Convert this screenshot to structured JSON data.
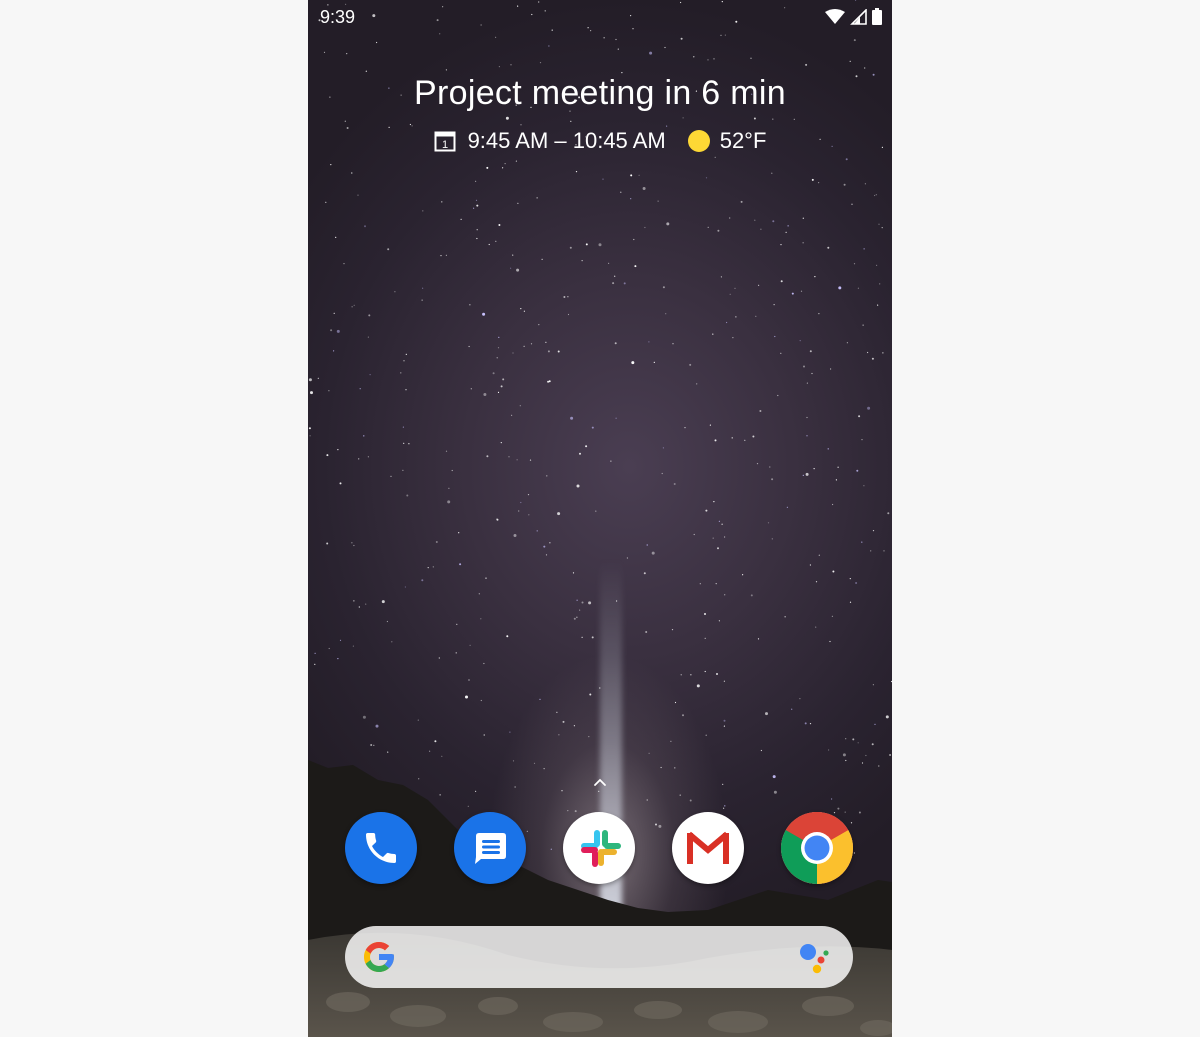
{
  "status_bar": {
    "time": "9:39",
    "icons": [
      "wifi-icon",
      "cell-signal-icon",
      "battery-icon"
    ]
  },
  "at_a_glance": {
    "title": "Project meeting in 6 min",
    "event_time": "9:45 AM – 10:45 AM",
    "calendar_day": "1",
    "temperature": "52°F",
    "weather_icon": "sun-icon"
  },
  "dock": {
    "apps": [
      {
        "name": "Phone",
        "icon": "phone-icon",
        "color": "#1a73e8"
      },
      {
        "name": "Messages",
        "icon": "messages-icon",
        "color": "#1a73e8"
      },
      {
        "name": "Slack",
        "icon": "slack-icon",
        "color": "#ffffff"
      },
      {
        "name": "Gmail",
        "icon": "gmail-icon",
        "color": "#ffffff"
      },
      {
        "name": "Chrome",
        "icon": "chrome-icon",
        "color": "#ffffff"
      }
    ]
  },
  "search_bar": {
    "logo": "google-g-icon",
    "assistant": "google-assistant-icon"
  },
  "colors": {
    "google_blue": "#4285f4",
    "google_red": "#ea4335",
    "google_yellow": "#fbbc05",
    "google_green": "#34a853",
    "sun": "#fdd835"
  }
}
